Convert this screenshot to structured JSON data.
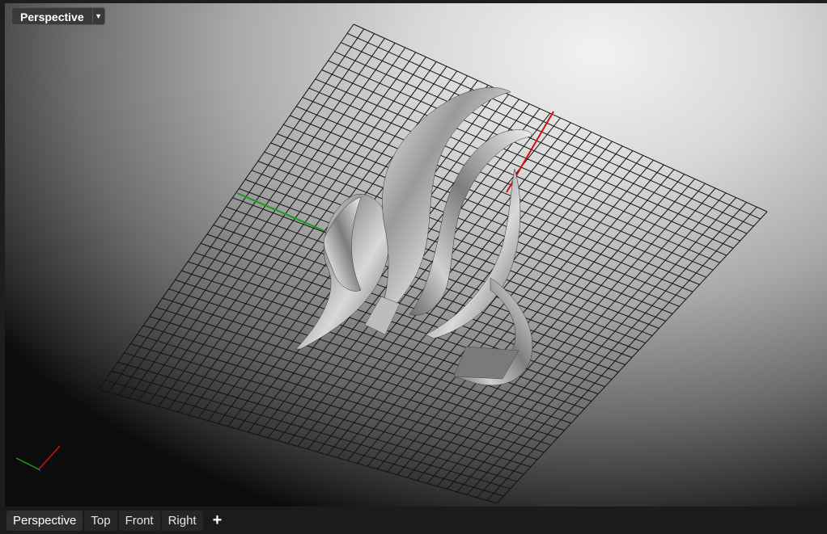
{
  "viewport": {
    "title": "Perspective",
    "menu_icon": "triangle-down-icon",
    "axis_colors": {
      "x": "#d01010",
      "y": "#1a9a1a",
      "z": "#2040ff"
    }
  },
  "tabs": {
    "items": [
      {
        "label": "Perspective"
      },
      {
        "label": "Top"
      },
      {
        "label": "Front"
      },
      {
        "label": "Right"
      }
    ],
    "add_label": "+"
  }
}
